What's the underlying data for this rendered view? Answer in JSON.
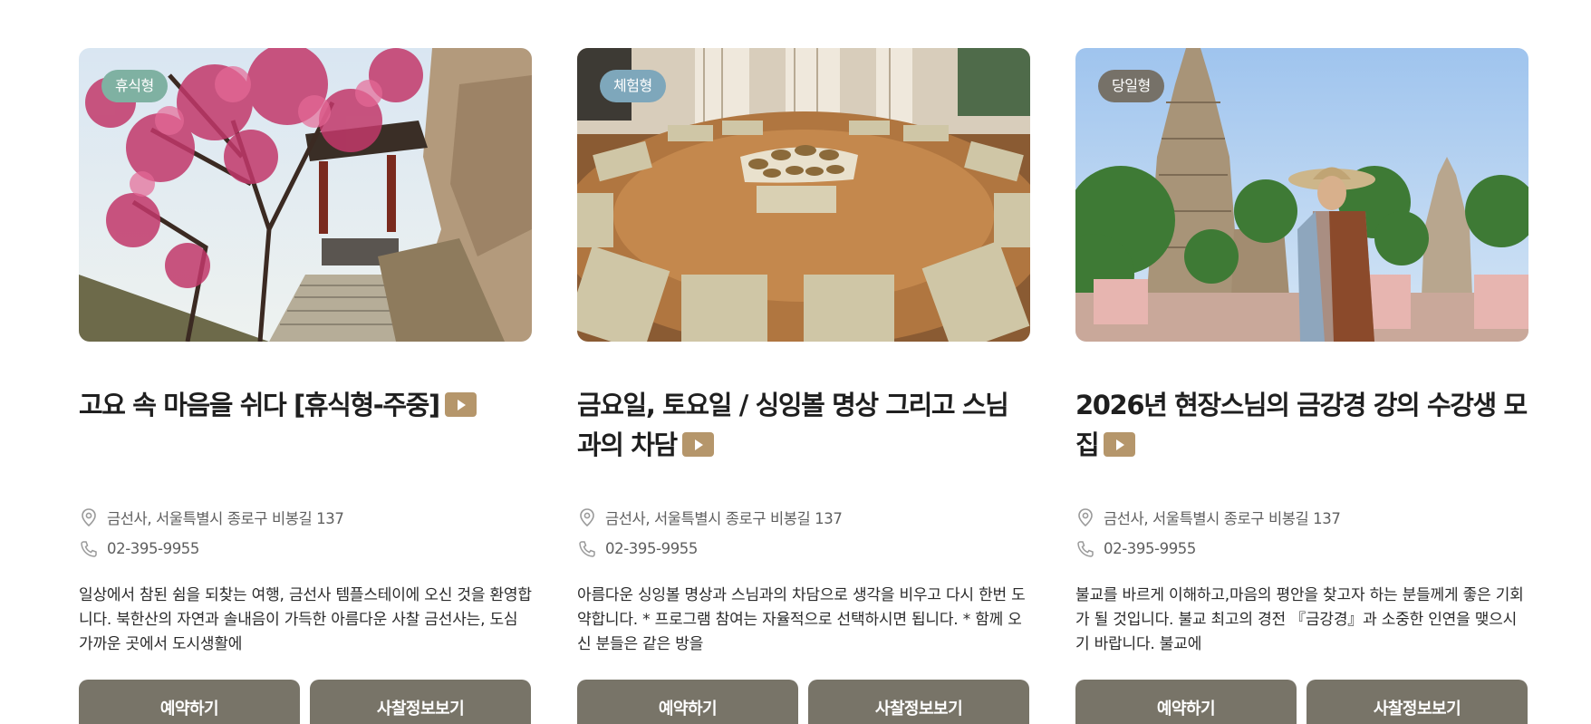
{
  "colors": {
    "badge_rest": "#7fb1a2",
    "badge_experience": "#7ea7bb",
    "badge_day": "#767168",
    "button": "#787468",
    "play": "#b5966b"
  },
  "cards": [
    {
      "badge": "휴식형",
      "image": "cherry-blossom-temple-stairs-photo",
      "title": "고요 속 마음을 쉬다 [휴식형-주중]",
      "address": "금선사, 서울특별시 종로구 비봉길 137",
      "phone": "02-395-9955",
      "description": "일상에서 참된 쉼을 되찾는 여행, 금선사 템플스테이에 오신 것을 환영합니다. 북한산의 자연과 솔내음이 가득한 아름다운 사찰 금선사는, 도심 가까운 곳에서 도시생활에",
      "reserve_label": "예약하기",
      "temple_info_label": "사찰정보보기"
    },
    {
      "badge": "체험형",
      "image": "singing-bowl-meditation-room-photo",
      "title": "금요일, 토요일 / 싱잉볼 명상 그리고 스님과의 차담",
      "address": "금선사, 서울특별시 종로구 비봉길 137",
      "phone": "02-395-9955",
      "description": "아름다운 싱잉볼 명상과 스님과의 차담으로 생각을 비우고 다시 한번 도약합니다. * 프로그램 참여는 자율적으로 선택하시면 됩니다. * 함께 오신 분들은 같은 방을",
      "reserve_label": "예약하기",
      "temple_info_label": "사찰정보보기"
    },
    {
      "badge": "당일형",
      "image": "monk-at-stupa-temple-photo",
      "title": "2026년 현장스님의 금강경 강의 수강생 모집",
      "address": "금선사, 서울특별시 종로구 비봉길 137",
      "phone": "02-395-9955",
      "description": "불교를 바르게 이해하고,마음의 평안을 찾고자 하는 분들께게 좋은 기회가 될 것입니다. 불교 최고의 경전 『금강경』과 소중한 인연을 맺으시기 바랍니다. 불교에",
      "reserve_label": "예약하기",
      "temple_info_label": "사찰정보보기"
    }
  ]
}
